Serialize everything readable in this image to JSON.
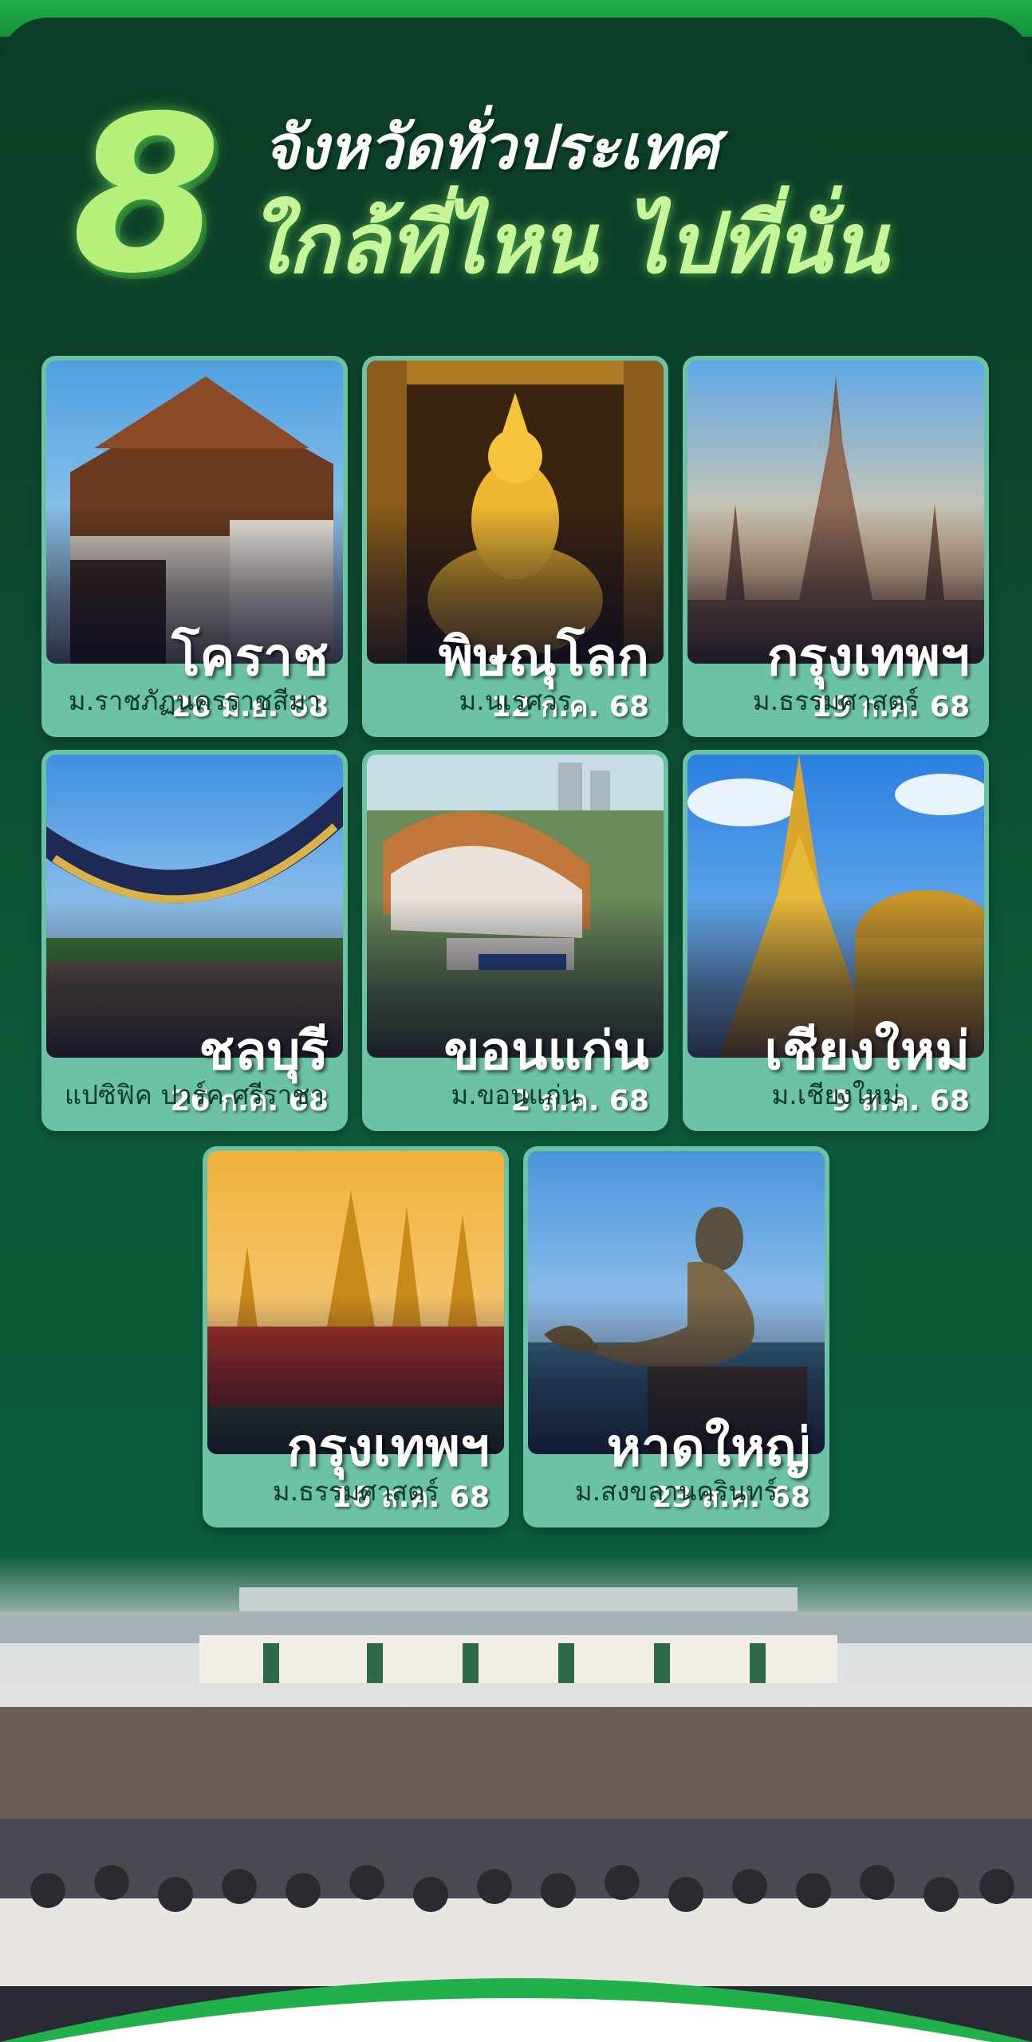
{
  "header": {
    "number": "8",
    "line1": "จังหวัดทั่วประเทศ",
    "line2": "ใกล้ที่ไหน ไปที่นั่น"
  },
  "events": [
    {
      "city": "โคราช",
      "date": "28 มิ.ย. 68",
      "venue": "ม.ราชภัฏนครราชสีมา"
    },
    {
      "city": "พิษณุโลก",
      "date": "12 ก.ค. 68",
      "venue": "ม.นเรศวร"
    },
    {
      "city": "กรุงเทพฯ",
      "date": "19 ก.ค. 68",
      "venue": "ม.ธรรมศาสตร์"
    },
    {
      "city": "ชลบุรี",
      "date": "26 ก.ค. 68",
      "venue": "แปซิฟิค ปาร์ค ศรีราชา"
    },
    {
      "city": "ขอนแก่น",
      "date": "2 ส.ค. 68",
      "venue": "ม.ขอนแก่น"
    },
    {
      "city": "เชียงใหม่",
      "date": "9 ส.ค. 68",
      "venue": "ม.เชียงใหม่"
    },
    {
      "city": "กรุงเทพฯ",
      "date": "16 ส.ค. 68",
      "venue": "ม.ธรรมศาสตร์"
    },
    {
      "city": "หาดใหญ่",
      "date": "23 ส.ค. 68",
      "venue": "ม.สงขลานครินทร์"
    }
  ],
  "colors": {
    "background": "#0d4a2f",
    "accent_green": "#22b04a",
    "card": "#6cc2a5",
    "title_green": "#c7f59a"
  }
}
